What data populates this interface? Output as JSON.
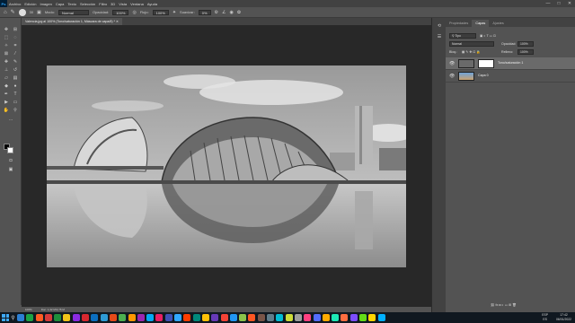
{
  "menu": {
    "app_logo": "Ps",
    "items": [
      "Archivo",
      "Edición",
      "Imagen",
      "Capa",
      "Texto",
      "Selección",
      "Filtro",
      "3D",
      "Vista",
      "Ventana",
      "Ayuda"
    ],
    "window_controls": [
      "—",
      "□",
      "✕"
    ]
  },
  "options": {
    "size_value": "30",
    "mode_label": "Modo:",
    "mode_value": "Normal",
    "opacity_label": "Opacidad:",
    "opacity_value": "100%",
    "flow_label": "Flujo:",
    "flow_value": "100%",
    "smoothing_label": "Suavizar:",
    "smoothing_value": "0%"
  },
  "document": {
    "tab_title": "Valencia.jpg al 100% (Tono/saturación 1, Máscara de capa/8) *"
  },
  "status": {
    "zoom": "100%",
    "doc_info": "Doc: 1,32 M/2,75 M"
  },
  "right_panel": {
    "tabs": [
      "Propiedades",
      "Capas",
      "Ajustes"
    ],
    "active_tab": "Capas",
    "kind_filter": "Tipo",
    "blend_mode": "Normal",
    "opacity_label": "Opacidad:",
    "opacity_value": "100%",
    "lock_label": "Bloq.:",
    "fill_label": "Relleno:",
    "fill_value": "100%",
    "layers": [
      {
        "name": "Tono/saturación 1",
        "selected": true
      },
      {
        "name": "Capa 0",
        "selected": false
      }
    ]
  },
  "taskbar": {
    "lang": "ESP",
    "lang2": "ES",
    "time": "17:42",
    "date": "06/01/2022",
    "app_colors": [
      "#2b7fd4",
      "#1ba345",
      "#ff5b23",
      "#d63a3a",
      "#1e8f3b",
      "#f0c419",
      "#8a2be2",
      "#d7282f",
      "#0b6fc1",
      "#2e9bd6",
      "#e64a19",
      "#4caf50",
      "#ff9800",
      "#9c27b0",
      "#03a9f4",
      "#e91e63",
      "#3f51b5",
      "#31a8ff",
      "#ff3d00",
      "#00897b",
      "#ffc107",
      "#673ab7",
      "#f44336",
      "#2196f3",
      "#8bc34a",
      "#ff5722",
      "#795548",
      "#607d8b",
      "#00bcd4",
      "#cddc39",
      "#9e9e9e",
      "#ff4081",
      "#536dfe",
      "#ffab00",
      "#1de9b6",
      "#ff6e40",
      "#7c4dff",
      "#64dd17",
      "#ffd600",
      "#00b0ff"
    ]
  },
  "colors": {
    "accent": "#31a8ff",
    "panel_bg": "#535353",
    "canvas_bg": "#282828"
  }
}
